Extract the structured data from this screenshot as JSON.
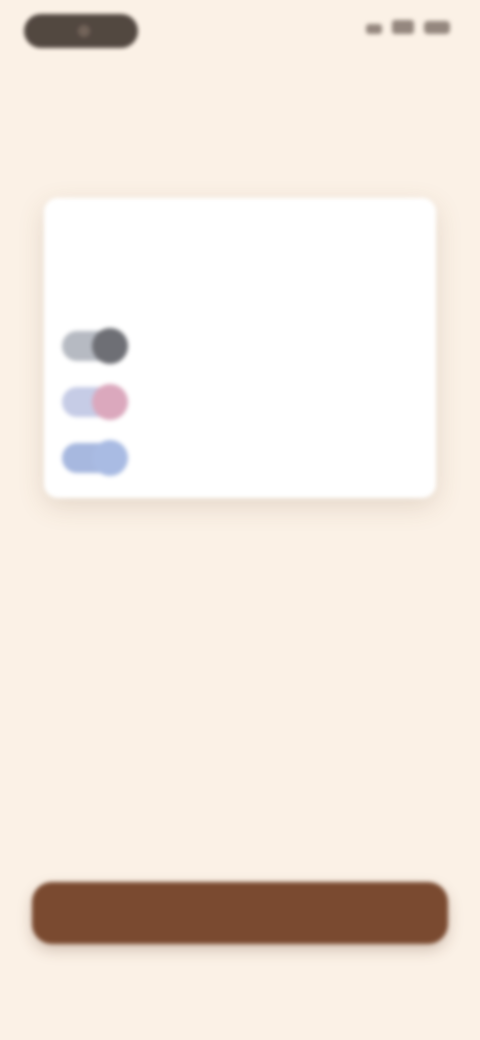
{
  "status_bar": {
    "time": "",
    "icons": [
      "signal-icon",
      "wifi-icon",
      "battery-icon"
    ]
  },
  "card": {
    "header": "",
    "subheader": "",
    "apps": [
      {
        "name": "",
        "icon": "app-icon",
        "toggle_color": "#b6bac2",
        "knob_color": "#6e6f75"
      },
      {
        "name": "",
        "icon": "app-icon",
        "toggle_color": "#c6cce6",
        "knob_color": "#dba8bd"
      },
      {
        "name": "",
        "icon": "app-icon",
        "toggle_color": "#a7b8df",
        "knob_color": "#a9bbe3"
      }
    ]
  },
  "main": {
    "title": "",
    "description": ""
  },
  "cta": {
    "label": ""
  },
  "colors": {
    "background": "#fbf1e6",
    "accent": "#7a4a30"
  }
}
